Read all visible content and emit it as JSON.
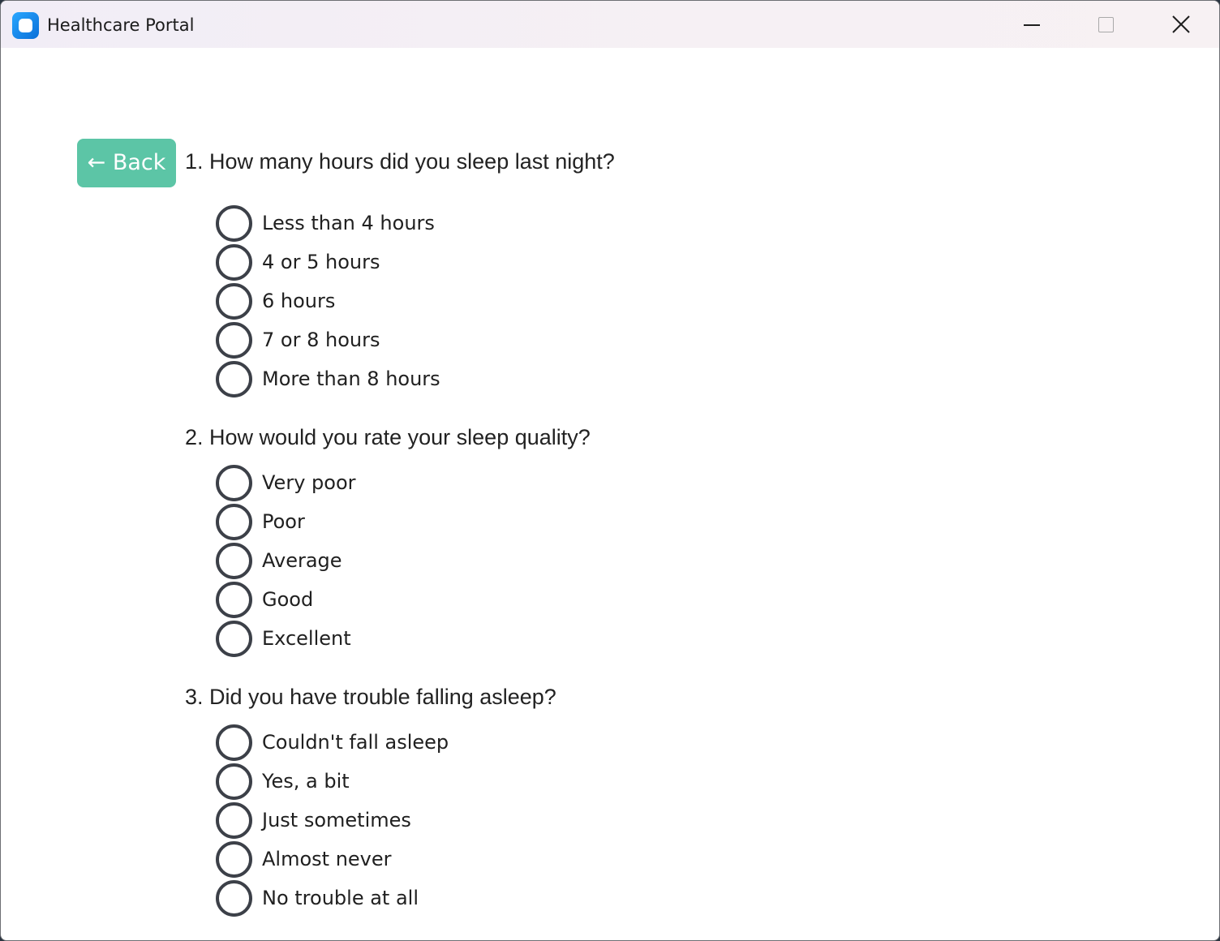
{
  "window": {
    "title": "Healthcare Portal",
    "app_icon": "app-icon",
    "controls": [
      "minimize-icon",
      "maximize-icon",
      "close-icon"
    ]
  },
  "back_button": {
    "label": "← Back"
  },
  "questions": [
    {
      "text": "1. How many hours did you sleep last night?",
      "options": [
        "Less than 4 hours",
        "4 or 5 hours",
        "6 hours",
        "7 or 8 hours",
        "More than 8 hours"
      ]
    },
    {
      "text": "2. How would you rate your sleep quality?",
      "options": [
        "Very poor",
        "Poor",
        "Average",
        "Good",
        "Excellent"
      ]
    },
    {
      "text": "3. Did you have trouble falling asleep?",
      "options": [
        "Couldn't fall asleep",
        "Yes, a bit",
        "Just sometimes",
        "Almost never",
        "No trouble at all"
      ]
    }
  ],
  "colors": {
    "back_button_bg": "#5cc5a6",
    "radio_border": "#3c4048"
  }
}
